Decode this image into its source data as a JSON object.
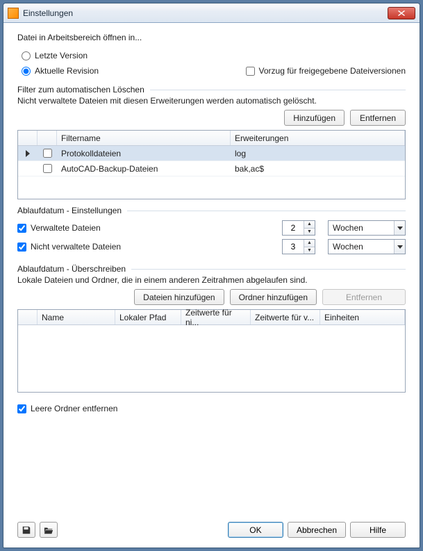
{
  "window": {
    "title": "Einstellungen"
  },
  "openIn": {
    "label": "Datei in Arbeitsbereich öffnen in...",
    "radio_latest": "Letzte Version",
    "radio_current": "Aktuelle Revision",
    "released_bias": "Vorzug für freigegebene Dateiversionen"
  },
  "filter": {
    "legend": "Filter zum automatischen Löschen",
    "desc": "Nicht verwaltete Dateien mit diesen Erweiterungen werden automatisch gelöscht.",
    "add": "Hinzufügen",
    "remove": "Entfernen",
    "col_name": "Filtername",
    "col_ext": "Erweiterungen",
    "rows": [
      {
        "name": "Protokolldateien",
        "ext": "log"
      },
      {
        "name": "AutoCAD-Backup-Dateien",
        "ext": "bak,ac$"
      }
    ]
  },
  "expiry": {
    "legend": "Ablaufdatum - Einstellungen",
    "managed": "Verwaltete Dateien",
    "unmanaged": "Nicht verwaltete Dateien",
    "managed_val": "2",
    "unmanaged_val": "3",
    "unit_managed": "Wochen",
    "unit_unmanaged": "Wochen"
  },
  "override": {
    "legend": "Ablaufdatum - Überschreiben",
    "desc": "Lokale Dateien und Ordner, die in einem anderen Zeitrahmen abgelaufen sind.",
    "add_files": "Dateien hinzufügen",
    "add_folders": "Ordner hinzufügen",
    "remove": "Entfernen",
    "col_name": "Name",
    "col_path": "Lokaler Pfad",
    "col_t1": "Zeitwerte für ni...",
    "col_t2": "Zeitwerte für v...",
    "col_unit": "Einheiten"
  },
  "delete_empty": "Leere Ordner entfernen",
  "buttons": {
    "ok": "OK",
    "cancel": "Abbrechen",
    "help": "Hilfe"
  }
}
